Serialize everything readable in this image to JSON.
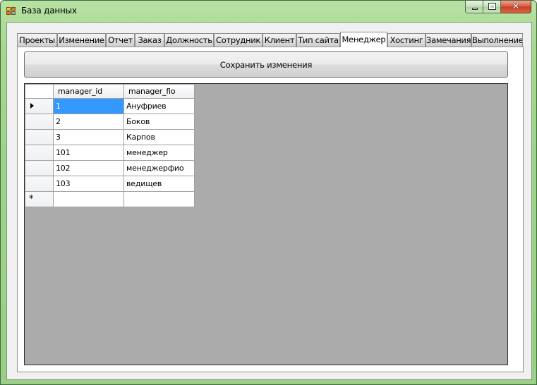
{
  "window": {
    "title": "База данных"
  },
  "tabs": [
    {
      "label": "Проекты",
      "active": false
    },
    {
      "label": "Изменение",
      "active": false
    },
    {
      "label": "Отчет",
      "active": false
    },
    {
      "label": "Заказ",
      "active": false
    },
    {
      "label": "Должность",
      "active": false
    },
    {
      "label": "Сотрудник",
      "active": false
    },
    {
      "label": "Клиент",
      "active": false
    },
    {
      "label": "Тип сайта",
      "active": false
    },
    {
      "label": "Менеджер",
      "active": true
    },
    {
      "label": "Хостинг",
      "active": false
    },
    {
      "label": "Замечания",
      "active": false
    },
    {
      "label": "Выполнение",
      "active": false
    }
  ],
  "toolbar": {
    "save_label": "Сохранить изменения"
  },
  "grid": {
    "columns": [
      "manager_id",
      "manager_fio"
    ],
    "rows": [
      {
        "manager_id": "1",
        "manager_fio": "Ануфриев"
      },
      {
        "manager_id": "2",
        "manager_fio": "Боков"
      },
      {
        "manager_id": "3",
        "manager_fio": "Карпов"
      },
      {
        "manager_id": "101",
        "manager_fio": "менеджер"
      },
      {
        "manager_id": "102",
        "manager_fio": "менеджерфио"
      },
      {
        "manager_id": "103",
        "manager_fio": "ведищев"
      }
    ],
    "current_row_glyph": "▶",
    "new_row_glyph": "*",
    "selected_cell_color": "#3399ff",
    "background_color": "#ababab"
  }
}
